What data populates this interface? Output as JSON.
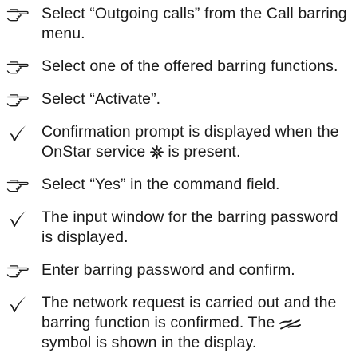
{
  "steps": [
    {
      "marker": "hand-pointer-icon",
      "parts": [
        {
          "text": "Select “Outgoing calls” from the Call barring menu."
        }
      ]
    },
    {
      "marker": "hand-pointer-icon",
      "parts": [
        {
          "text": "Select one of the offered barring functions."
        }
      ]
    },
    {
      "marker": "hand-pointer-icon",
      "parts": [
        {
          "text": "Select “Activate”."
        }
      ]
    },
    {
      "marker": "checkmark-icon",
      "parts": [
        {
          "text": "Confirmation prompt is displayed when the OnStar service "
        },
        {
          "icon": "onstar-service-icon"
        },
        {
          "text": " is present."
        }
      ]
    },
    {
      "marker": "hand-pointer-icon",
      "parts": [
        {
          "text": "Select “Yes” in the command field."
        }
      ]
    },
    {
      "marker": "checkmark-icon",
      "parts": [
        {
          "text": "The input window for the barring password is displayed."
        }
      ]
    },
    {
      "marker": "hand-pointer-icon",
      "parts": [
        {
          "text": "Enter barring password and confirm."
        }
      ]
    },
    {
      "marker": "checkmark-icon",
      "parts": [
        {
          "text": "The network request is carried out and the barring function is confirmed. The "
        },
        {
          "icon": "call-barring-symbol-icon"
        },
        {
          "text": " symbol is shown in the display."
        }
      ]
    }
  ],
  "colors": {
    "text": "#1a1a1a",
    "background": "#ffffff"
  }
}
